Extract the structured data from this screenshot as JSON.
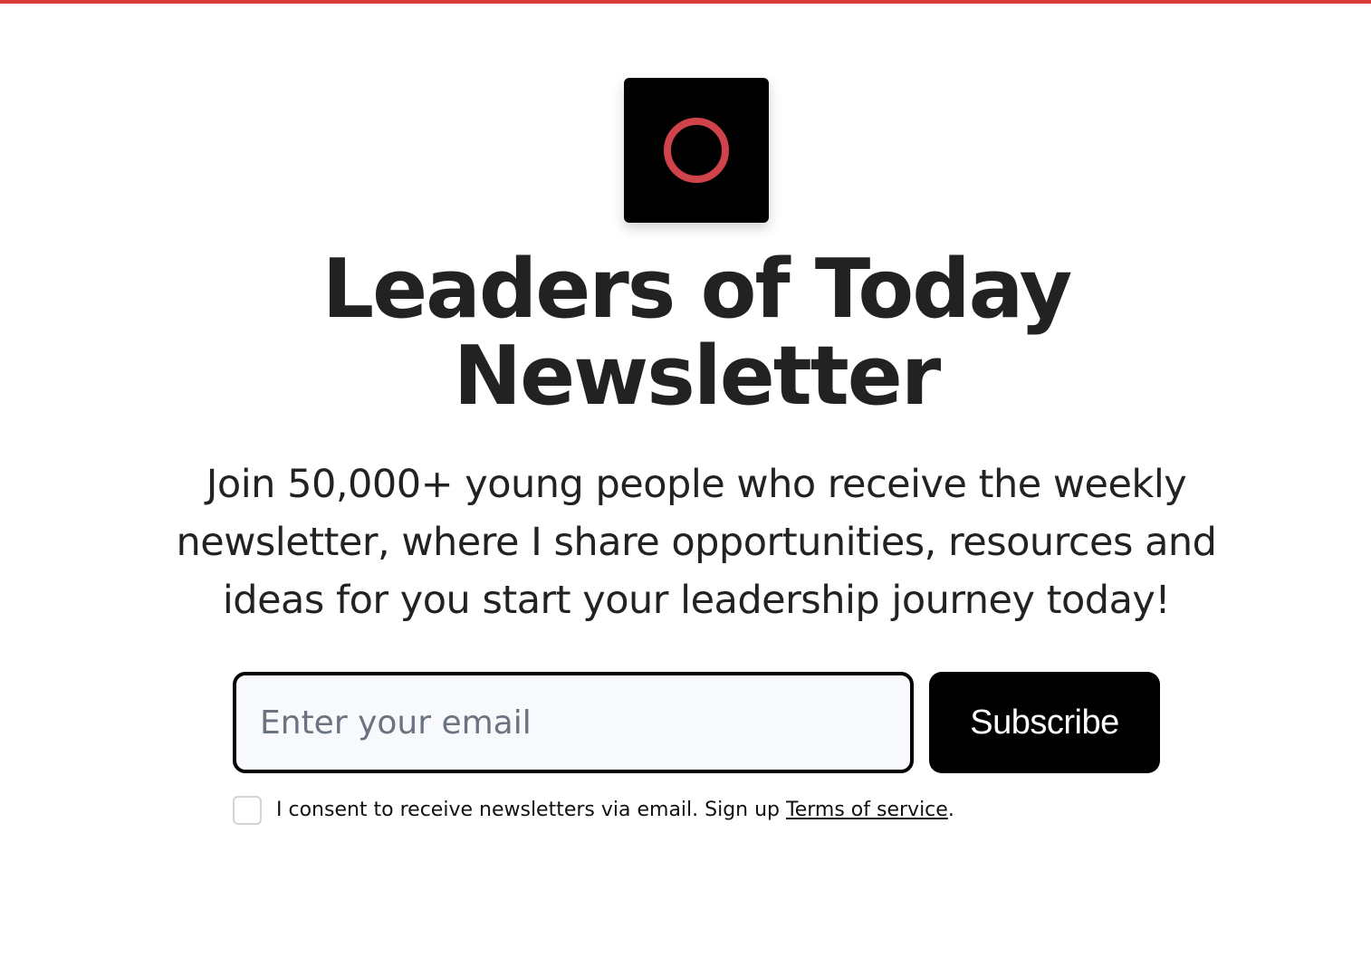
{
  "colors": {
    "accent": "#dc3b3b",
    "logo_background": "#000000",
    "logo_ring": "#d1434b",
    "button_background": "#000000",
    "button_text": "#ffffff",
    "input_background": "#f7f9fc"
  },
  "logo": {
    "icon": "ring-logo-icon"
  },
  "hero": {
    "title_line1": "Leaders of Today",
    "title_line2": "Newsletter",
    "description": "Join 50,000+ young people who receive the weekly newsletter, where I share opportunities, resources and ideas for you start your leadership journey today!"
  },
  "form": {
    "email_value": "",
    "email_placeholder": "Enter your email",
    "subscribe_label": "Subscribe"
  },
  "consent": {
    "checked": false,
    "text": "I consent to receive newsletters via email. Sign up ",
    "link_text": "Terms of service",
    "trailing": "."
  }
}
